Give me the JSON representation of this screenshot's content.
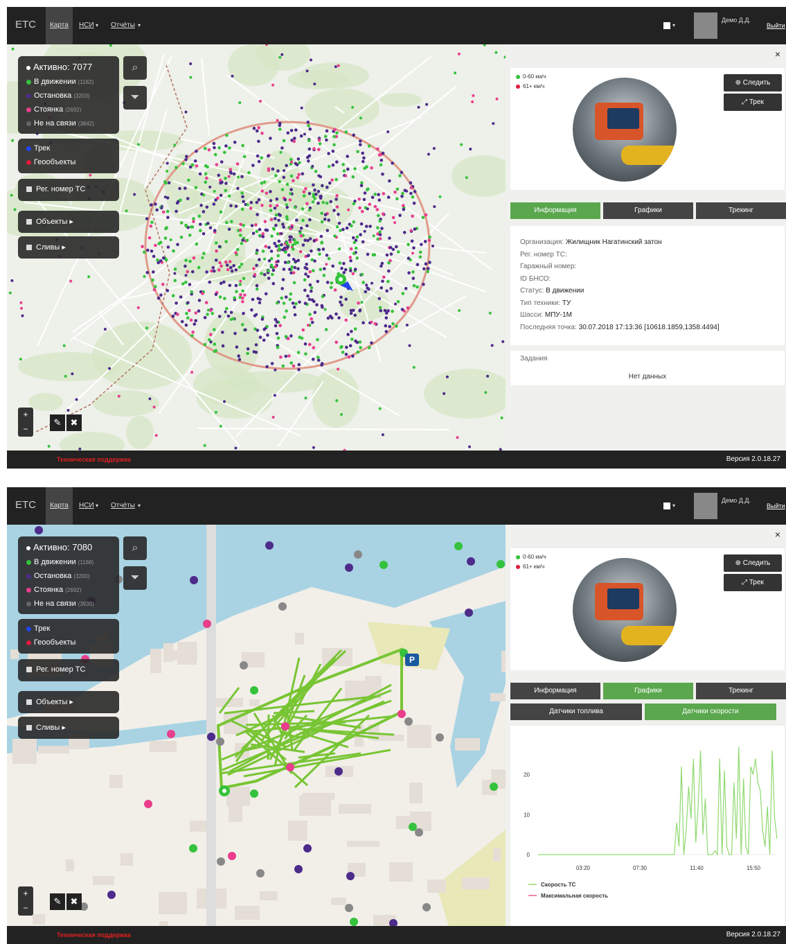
{
  "screens": [
    {
      "brand": "ЕТС",
      "nav": {
        "map": "Карта",
        "nsi": "НСИ",
        "reports": "Отчёты"
      },
      "user": "Демо Д.Д.",
      "logout": "Выйти",
      "filter_panel": {
        "active": "Активно: 7077",
        "statuses": [
          {
            "label": "В движении",
            "count": "(1182)",
            "color": "#35c23c"
          },
          {
            "label": "Остановка",
            "count": "(3203)",
            "color": "#4d2b8a"
          },
          {
            "label": "Стоянка",
            "count": "(2692)",
            "color": "#e83e8c"
          },
          {
            "label": "Не на связи",
            "count": "(3842)",
            "color": "#666666"
          }
        ],
        "layers": [
          {
            "label": "Трек",
            "color": "#2244ee"
          },
          {
            "label": "Геообъекты",
            "color": "#e01b3c"
          }
        ],
        "reg_number": "Рег. номер ТС",
        "objects": "Объекты ▸",
        "drains": "Сливы ▸"
      },
      "zoom": {
        "in": "+",
        "out": "−"
      },
      "tools": {
        "draw": "✎",
        "clear": "✖"
      },
      "speed_legend": [
        "0-60 км/ч",
        "61+ км/ч"
      ],
      "speed_colors": [
        "#35c23c",
        "#e01b3c"
      ],
      "follow_button": "Следить",
      "track_button": "Трек",
      "close": "×",
      "tabs": [
        "Информация",
        "Графики",
        "Трекинг"
      ],
      "active_tab": 0,
      "info": {
        "org_label": "Организация:",
        "org_value": "Жилищник Нагатинский затон",
        "reg_label": "Рег. номер ТС:",
        "garage_label": "Гаражный номер:",
        "bnso_label": "ID БНСО:",
        "status_label": "Статус:",
        "status_value": "В движении",
        "type_label": "Тип техники:",
        "type_value": "ТУ",
        "chassis_label": "Шасси:",
        "chassis_value": "МПУ-1М",
        "last_label": "Последняя точка:",
        "last_value": "30.07.2018 17:13:36 [10618.1859,1358.4494]"
      },
      "tasks_title": "Задания",
      "tasks_empty": "Нет данных",
      "support": "Техническая поддержка",
      "version": "Версия 2.0.18.27"
    },
    {
      "brand": "ЕТС",
      "nav": {
        "map": "Карта",
        "nsi": "НСИ",
        "reports": "Отчёты"
      },
      "user": "Демо Д.Д.",
      "logout": "Выйти",
      "filter_panel": {
        "active": "Активно: 7080",
        "statuses": [
          {
            "label": "В движении",
            "count": "(1188)",
            "color": "#35c23c"
          },
          {
            "label": "Остановка",
            "count": "(3200)",
            "color": "#4d2b8a"
          },
          {
            "label": "Стоянка",
            "count": "(2692)",
            "color": "#e83e8c"
          },
          {
            "label": "Не на связи",
            "count": "(3939)",
            "color": "#666666"
          }
        ],
        "layers": [
          {
            "label": "Трек",
            "color": "#2244ee"
          },
          {
            "label": "Геообъекты",
            "color": "#e01b3c"
          }
        ],
        "reg_number": "Рег. номер ТС",
        "objects": "Объекты ▸",
        "drains": "Сливы ▸"
      },
      "zoom": {
        "in": "+",
        "out": "−"
      },
      "tools": {
        "draw": "✎",
        "clear": "✖"
      },
      "speed_legend": [
        "0-60 км/ч",
        "61+ км/ч"
      ],
      "speed_colors": [
        "#35c23c",
        "#e01b3c"
      ],
      "follow_button": "Следить",
      "track_button": "Трек",
      "close": "×",
      "tabs": [
        "Информация",
        "Графики",
        "Трекинг"
      ],
      "active_tab": 1,
      "subtabs": [
        "Датчики топлива",
        "Датчики скорости"
      ],
      "active_subtab": 1,
      "parking_marker": "P",
      "support": "Техническая поддержка",
      "version": "Версия 2.0.18.27"
    }
  ],
  "chart_data": {
    "type": "line",
    "x_ticks": [
      "03:20",
      "07:30",
      "11:40",
      "15:50"
    ],
    "y_ticks": [
      "0",
      "10",
      "20"
    ],
    "ylim": [
      0,
      26
    ],
    "series": [
      {
        "name": "Скорость ТС",
        "color": "#8fd96f",
        "x": [
          0,
          0.3,
          0.57,
          0.58,
          0.59,
          0.6,
          0.61,
          0.62,
          0.63,
          0.64,
          0.65,
          0.66,
          0.67,
          0.68,
          0.69,
          0.7,
          0.71,
          0.72,
          0.73,
          0.74,
          0.75,
          0.76,
          0.77,
          0.78,
          0.79,
          0.8,
          0.81,
          0.82,
          0.83,
          0.84,
          0.85,
          0.86,
          0.87,
          0.88,
          0.89,
          0.9,
          0.91,
          0.92,
          0.93,
          0.94,
          0.95,
          0.96,
          0.97,
          0.98,
          0.99,
          1.0
        ],
        "y": [
          0,
          0,
          0,
          8,
          2,
          22,
          0,
          6,
          17,
          9,
          24,
          3,
          12,
          26,
          5,
          14,
          0,
          0,
          0,
          1,
          0,
          24,
          0,
          21,
          2,
          0,
          0,
          18,
          4,
          27,
          0,
          19,
          2,
          0,
          22,
          20,
          24,
          18,
          16,
          6,
          2,
          12,
          0,
          26,
          9,
          4
        ]
      },
      {
        "name": "Максимальная скорость",
        "color": "#e8608a",
        "x": [],
        "y": []
      }
    ]
  }
}
